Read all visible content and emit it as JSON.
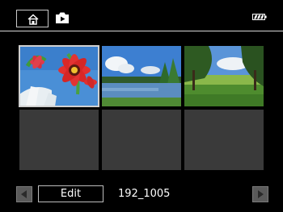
{
  "header": {
    "home_icon": "home-icon",
    "camera_icon": "camera-play-icon",
    "battery_icon": "battery-icon"
  },
  "thumbnails": [
    {
      "content": "red-flower-photo"
    },
    {
      "content": "lake-landscape-photo"
    },
    {
      "content": "field-trees-photo"
    },
    {
      "content": "empty"
    },
    {
      "content": "empty"
    },
    {
      "content": "empty"
    }
  ],
  "footer": {
    "prev_icon": "left-arrow-icon",
    "edit_label": "Edit",
    "folder_name": "192_1005",
    "next_icon": "right-arrow-icon"
  },
  "colors": {
    "background": "#000000",
    "empty_slot": "#3a3a3a",
    "arrow_button": "#5a5a5a"
  }
}
